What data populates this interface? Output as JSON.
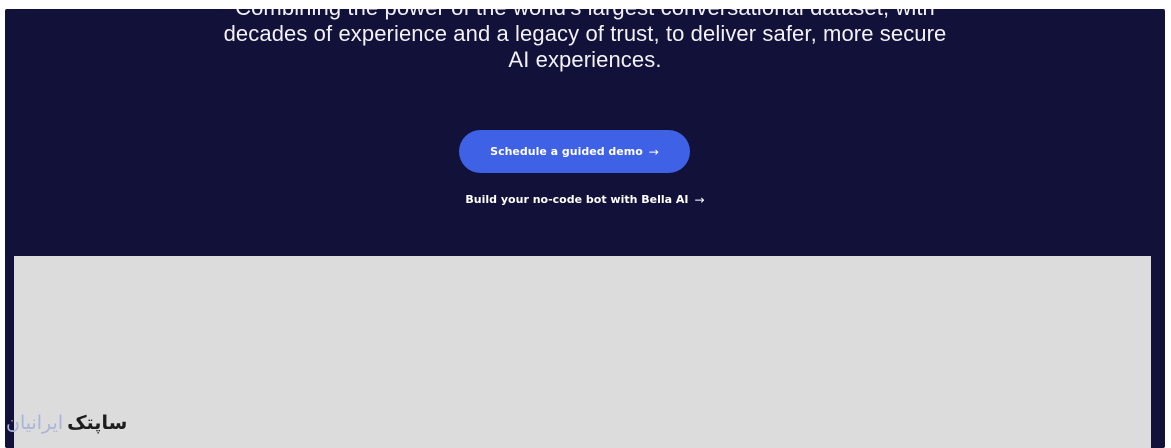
{
  "hero": {
    "line1": "Combining the power of the world's largest conversational dataset, with",
    "line2": "decades of experience and a legacy of trust, to deliver safer, more secure",
    "line3": "AI experiences."
  },
  "cta": {
    "label": "Schedule a guided demo",
    "arrow": "→"
  },
  "secondary": {
    "label": "Build your no-code bot with Bella AI",
    "arrow": "→"
  },
  "watermark": {
    "dark": "ساپتک",
    "light": "ایرانیان"
  },
  "colors": {
    "background": "#121139",
    "button": "#3e61e6",
    "panel": "#dcdcdc"
  }
}
